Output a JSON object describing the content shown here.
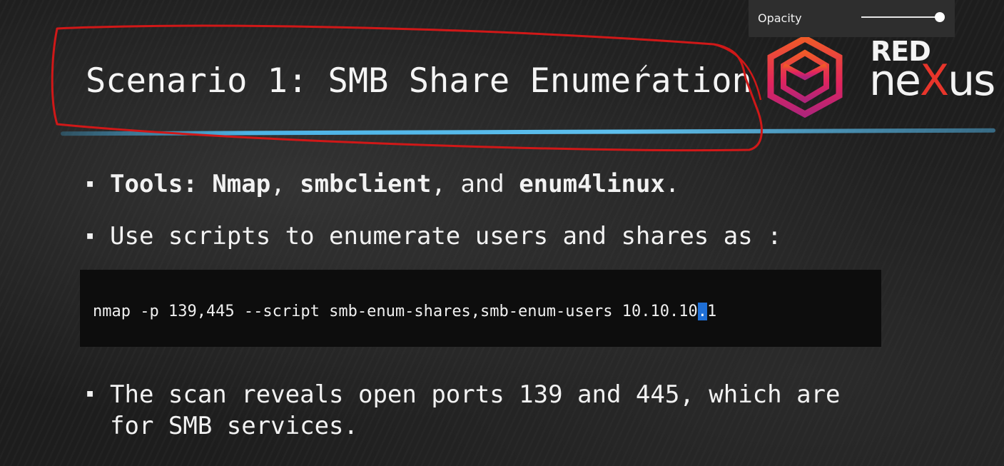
{
  "slide": {
    "title": "Scenario 1: SMB Share Enumeration",
    "bullets": {
      "b1": {
        "prefix": "Tools: ",
        "tool1": "Nmap",
        "sep1": ", ",
        "tool2": "smbclient",
        "sep2": ", and ",
        "tool3": "enum4linux",
        "suffix": "."
      },
      "b2": "Use scripts to enumerate users and shares as :",
      "b3_line1": "The scan reveals open ports 139 and 445, which are",
      "b3_line2": "for SMB services."
    },
    "bullet_symbol": "▪",
    "code": {
      "before": "nmap -p 139,445 --script smb-enum-shares,smb-enum-users 10.10.10",
      "selected": ".",
      "after": "1"
    }
  },
  "logo": {
    "line1": "RED",
    "line2a": "ne",
    "line2b": "X",
    "line2c": "us",
    "accent_color": "#e8352b",
    "gradient_colors": [
      "#f05a28",
      "#e0245e",
      "#b0247a"
    ]
  },
  "opacity_control": {
    "label": "Opacity",
    "value": 0.95
  },
  "colors": {
    "annotation": "#d01818",
    "underline": "#4cb3e6",
    "selection": "#1f6fd6"
  }
}
